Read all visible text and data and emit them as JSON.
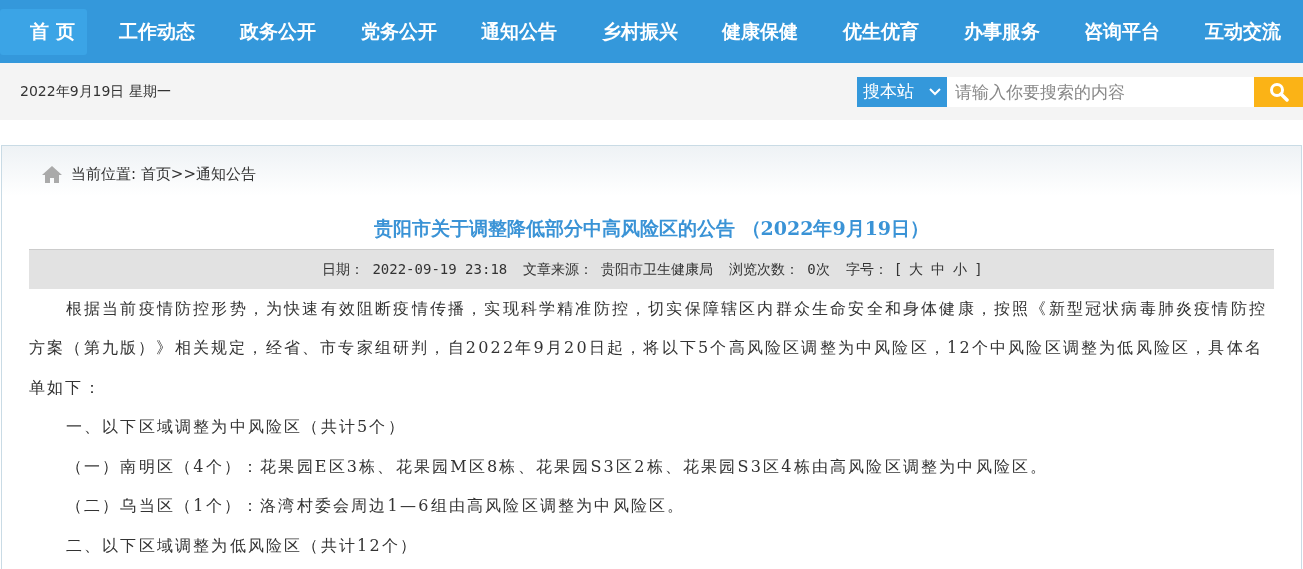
{
  "nav": {
    "items": [
      {
        "label": "首 页",
        "selected": true
      },
      {
        "label": "工作动态",
        "selected": false
      },
      {
        "label": "政务公开",
        "selected": false
      },
      {
        "label": "党务公开",
        "selected": false
      },
      {
        "label": "通知公告",
        "selected": false
      },
      {
        "label": "乡村振兴",
        "selected": false
      },
      {
        "label": "健康保健",
        "selected": false
      },
      {
        "label": "优生优育",
        "selected": false
      },
      {
        "label": "办事服务",
        "selected": false
      },
      {
        "label": "咨询平台",
        "selected": false
      },
      {
        "label": "互动交流",
        "selected": false
      }
    ]
  },
  "date_bar": {
    "date": "2022年9月19日  星期一",
    "search": {
      "scope": "搜本站",
      "placeholder": "请输入你要搜索的内容"
    }
  },
  "breadcrumb": "当前位置: 首页>>通知公告",
  "article": {
    "title": "贵阳市关于调整降低部分中高风险区的公告 （2022年9月19日）",
    "meta": [
      {
        "label": "日期：",
        "value": "2022-09-19 23:18"
      },
      {
        "label": "文章来源：",
        "value": "贵阳市卫生健康局"
      },
      {
        "label": "浏览次数：",
        "value": "0次"
      }
    ],
    "font_size": {
      "label": "字号：",
      "open": "[",
      "options": [
        "大",
        "中",
        "小"
      ],
      "close": "]"
    },
    "paragraphs": [
      "根据当前疫情防控形势，为快速有效阻断疫情传播，实现科学精准防控，切实保障辖区内群众生命安全和身体健康，按照《新型冠状病毒肺炎疫情防控方案（第九版）》相关规定，经省、市专家组研判，自2022年9月20日起，将以下5个高风险区调整为中风险区，12个中风险区调整为低风险区，具体名单如下：",
      "一、以下区域调整为中风险区（共计5个）",
      "（一）南明区（4个）：花果园E区3栋、花果园M区8栋、花果园S3区2栋、花果园S3区4栋由高风险区调整为中风险区。",
      "（二）乌当区（1个）：洛湾村委会周边1—6组由高风险区调整为中风险区。",
      "二、以下区域调整为低风险区（共计12个）"
    ]
  }
}
